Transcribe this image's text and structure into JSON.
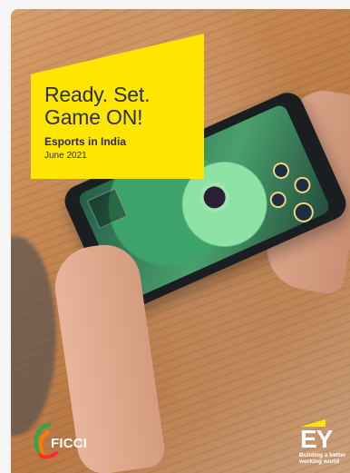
{
  "cover": {
    "headline_line_1": "Ready. Set.",
    "headline_line_2": "Game ON!",
    "subtitle": "Esports in India",
    "date": "June 2021"
  },
  "branding": {
    "ficci": "FICCI",
    "ey": "EY",
    "ey_tagline_line_1": "Building a better",
    "ey_tagline_line_2": "working world"
  },
  "colors": {
    "accent": "#ffe600",
    "text_dark": "#2e2e38",
    "wood": "#c48652"
  },
  "icons": {
    "ficci_logo": "ficci-logo-icon",
    "ey_logo": "ey-logo-icon",
    "phone": "phone-icon"
  }
}
